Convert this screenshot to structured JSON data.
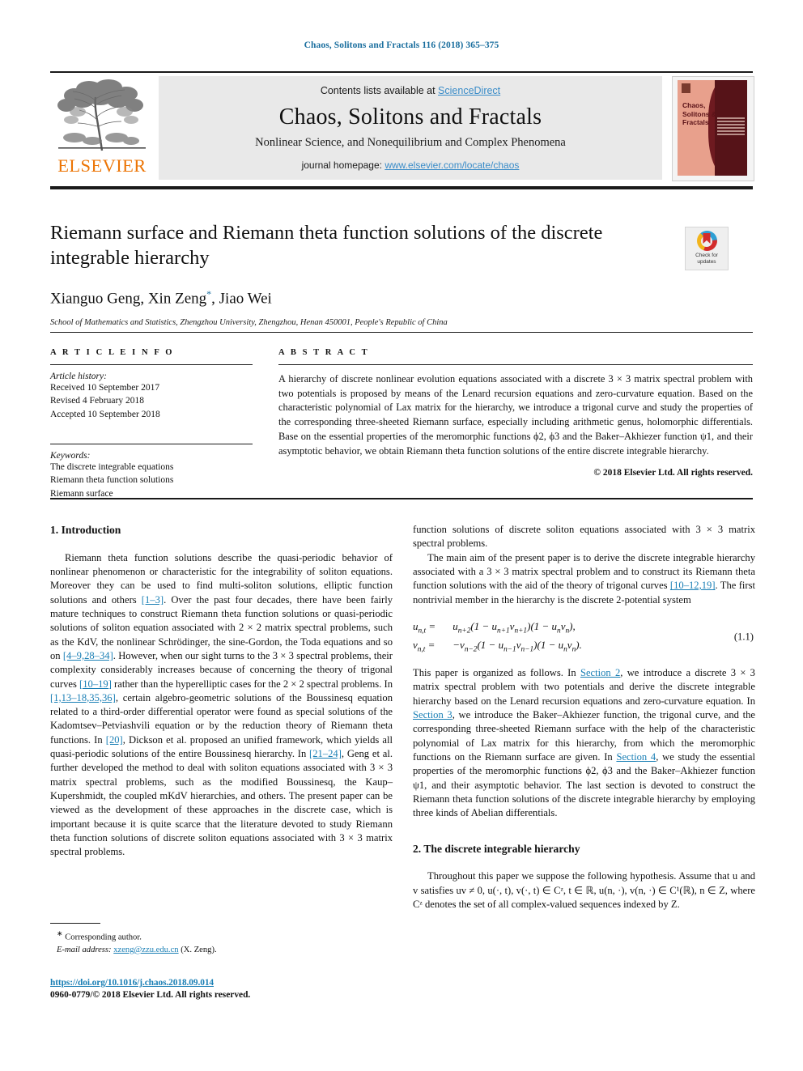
{
  "running_head": "Chaos, Solitons and Fractals 116 (2018) 365–375",
  "masthead": {
    "contents_prefix": "Contents lists available at ",
    "sciencedirect": "ScienceDirect",
    "journal_title": "Chaos, Solitons and Fractals",
    "journal_subtitle": "Nonlinear Science, and Nonequilibrium and Complex Phenomena",
    "homepage_prefix": "journal homepage: ",
    "homepage_url": "www.elsevier.com/locate/chaos",
    "publisher_wordmark": "ELSEVIER",
    "cover_title": "Chaos, Solitons & Fractals",
    "colors": {
      "link_blue": "#3a8cc8",
      "elsevier_orange": "#ec7404",
      "panel_gray": "#e9e9e9",
      "running_head_blue": "#1a6e9e"
    }
  },
  "crossmark": {
    "line1": "Check for",
    "line2": "updates"
  },
  "article": {
    "title": "Riemann surface and Riemann theta function solutions of the discrete integrable hierarchy",
    "authors": "Xianguo Geng, Xin Zeng",
    "authors_suffix": ", Jiao Wei",
    "corresponding_marker": "*",
    "affiliation": "School of Mathematics and Statistics, Zhengzhou University, Zhengzhou, Henan 450001, People's Republic of China"
  },
  "article_info": {
    "heading": "A R T I C L E   I N F O",
    "history_label": "Article history:",
    "history": [
      "Received 10 September 2017",
      "Revised 4 February 2018",
      "Accepted 10 September 2018"
    ],
    "keywords_label": "Keywords:",
    "keywords": [
      "The discrete integrable equations",
      "Riemann theta function solutions",
      "Riemann surface"
    ]
  },
  "abstract": {
    "heading": "A B S T R A C T",
    "text": "A hierarchy of discrete nonlinear evolution equations associated with a discrete 3 × 3 matrix spectral problem with two potentials is proposed by means of the Lenard recursion equations and zero-curvature equation. Based on the characteristic polynomial of Lax matrix for the hierarchy, we introduce a trigonal curve and study the properties of the corresponding three-sheeted Riemann surface, especially including arithmetic genus, holomorphic differentials. Base on the essential properties of the meromorphic functions ϕ2, ϕ3 and the Baker–Akhiezer function ψ1, and their asymptotic behavior, we obtain Riemann theta function solutions of the entire discrete integrable hierarchy.",
    "copyright": "© 2018 Elsevier Ltd. All rights reserved."
  },
  "body": {
    "section1_heading": "1. Introduction",
    "section1_p1_a": "Riemann theta function solutions describe the quasi-periodic behavior of nonlinear phenomenon or characteristic for the integrability of soliton equations. Moreover they can be used to find multi-soliton solutions, elliptic function solutions and others ",
    "ref_1_3": "[1–3]",
    "section1_p1_b": ". Over the past four decades, there have been fairly mature techniques to construct Riemann theta function solutions or quasi-periodic solutions of soliton equation associated with 2 × 2 matrix spectral problems, such as the KdV, the nonlinear Schrödinger, the sine-Gordon, the Toda equations and so on ",
    "ref_4_9": "[4–9,28–34]",
    "section1_p1_c": ". However, when our sight turns to the 3 × 3 spectral problems, their complexity considerably increases because of concerning the theory of trigonal curves ",
    "ref_10_19": "[10–19]",
    "section1_p1_d": " rather than the hyperelliptic cases for the 2 × 2 spectral problems. In ",
    "ref_1_13": "[1,13–18,35,36]",
    "section1_p1_e": ", certain algebro-geometric solutions of the Boussinesq equation related to a third-order differential operator were found as special solutions of the Kadomtsev–Petviashvili equation or by the reduction theory of Riemann theta functions. In ",
    "ref_20": "[20]",
    "section1_p1_f": ", Dickson et al. proposed an unified framework, which yields all quasi-periodic solutions of the entire Boussinesq hierarchy. In ",
    "ref_21_24": "[21–24]",
    "section1_p1_g": ", Geng et al. further developed the method to deal with soliton equations associated with 3 × 3 matrix spectral problems, such as the modified Boussinesq, the Kaup–Kupershmidt, the coupled mKdV hierarchies, and others. The present paper can be viewed as the development of these approaches in the discrete case, which is important because it is quite scarce that the literature devoted to study Riemann theta function solutions of discrete soliton equations associated with 3 × 3 matrix spectral problems.",
    "section1_p2_a": "The main aim of the present paper is to derive the discrete integrable hierarchy associated with a 3 × 3 matrix spectral problem and to construct its Riemann theta function solutions with the aid of the theory of trigonal curves ",
    "ref_10_12": "[10–12,19]",
    "section1_p2_b": ". The first nontrivial member in the hierarchy is the discrete 2-potential system",
    "equation": {
      "row1_lhs": "u",
      "row1_lhs_sub": "n,t",
      "row1_eq": " = ",
      "row1_rhs": "uₙ₊₂(1 − uₙ₊₁vₙ₊₁)(1 − uₙvₙ),",
      "row2_lhs": "v",
      "row2_lhs_sub": "n,t",
      "row2_eq": " = ",
      "row2_rhs": "−vₙ₋₂(1 − uₙ₋₁vₙ₋₁)(1 − uₙvₙ).",
      "number": "(1.1)"
    },
    "section1_p3_a": "This paper is organized as follows. In ",
    "link_section2": "Section 2",
    "section1_p3_b": ", we introduce a discrete 3 × 3 matrix spectral problem with two potentials and derive the discrete integrable hierarchy based on the Lenard recursion equations and zero-curvature equation. In ",
    "link_section3": "Section 3",
    "section1_p3_c": ", we introduce the Baker–Akhiezer function, the trigonal curve, and the corresponding three-sheeted Riemann surface with the help of the characteristic polynomial of Lax matrix for this hierarchy, from which the meromorphic functions on the Riemann surface are given. In ",
    "link_section4": "Section 4",
    "section1_p3_d": ", we study the essential properties of the meromorphic functions ϕ2, ϕ3 and the Baker–Akhiezer function ψ1, and their asymptotic behavior. The last section is devoted to construct the Riemann theta function solutions of the discrete integrable hierarchy by employing three kinds of Abelian differentials.",
    "section2_heading": "2. The discrete integrable hierarchy",
    "section2_p1": "Throughout this paper we suppose the following hypothesis. Assume that u and v satisfies uv ≠ 0, u(·, t),  v(·, t) ∈ Cᶻ,  t ∈ ℝ,  u(n, ·),  v(n, ·) ∈ C¹(ℝ),  n ∈ Z, where Cᶻ denotes the set of all complex-valued sequences indexed by Z."
  },
  "footnote": {
    "corresponding": "Corresponding author.",
    "email_label": "E-mail address:",
    "email": "xzeng@zzu.edu.cn",
    "email_owner": "(X. Zeng)."
  },
  "footer": {
    "doi": "https://doi.org/10.1016/j.chaos.2018.09.014",
    "issn_line": "0960-0779/© 2018 Elsevier Ltd. All rights reserved."
  }
}
